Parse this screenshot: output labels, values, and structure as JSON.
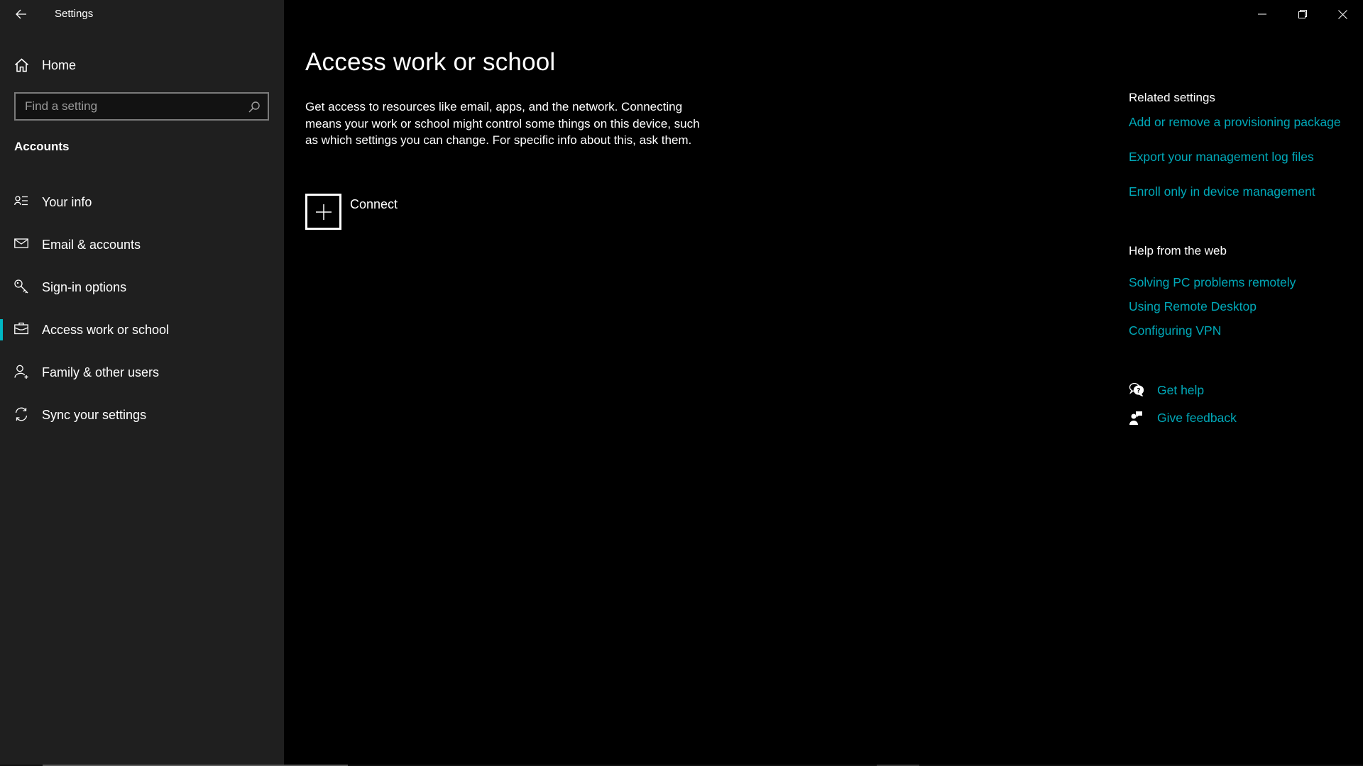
{
  "window": {
    "title": "Settings",
    "controls": {
      "minimize": "minimize-icon",
      "restore": "restore-icon",
      "close": "close-icon"
    }
  },
  "sidebar": {
    "home_label": "Home",
    "search_placeholder": "Find a setting",
    "search_value": "",
    "section_label": "Accounts",
    "items": [
      {
        "label": "Your info",
        "icon": "contact-info-icon",
        "selected": false
      },
      {
        "label": "Email & accounts",
        "icon": "mail-icon",
        "selected": false
      },
      {
        "label": "Sign-in options",
        "icon": "key-icon",
        "selected": false
      },
      {
        "label": "Access work or school",
        "icon": "briefcase-icon",
        "selected": true
      },
      {
        "label": "Family & other users",
        "icon": "add-user-icon",
        "selected": false
      },
      {
        "label": "Sync your settings",
        "icon": "sync-icon",
        "selected": false
      }
    ]
  },
  "main": {
    "title": "Access work or school",
    "description": "Get access to resources like email, apps, and the network. Connecting means your work or school might control some things on this device, such as which settings you can change. For specific info about this, ask them.",
    "connect_label": "Connect"
  },
  "related": {
    "heading": "Related settings",
    "links": [
      "Add or remove a provisioning package",
      "Export your management log files",
      "Enroll only in device management"
    ]
  },
  "help_web": {
    "heading": "Help from the web",
    "links": [
      "Solving PC problems remotely",
      "Using Remote Desktop",
      "Configuring VPN"
    ]
  },
  "support": {
    "get_help": "Get help",
    "give_feedback": "Give feedback"
  },
  "colors": {
    "accent": "#00b7c3",
    "link": "#00a9b9",
    "sidebar_bg": "#1f1f1f",
    "main_bg": "#000000"
  }
}
